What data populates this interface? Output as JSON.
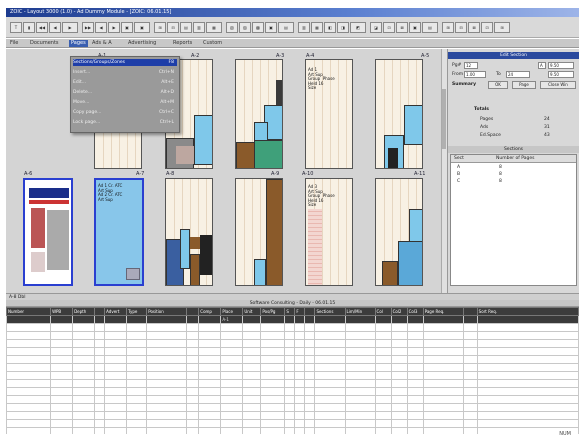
{
  "window": {
    "title": "ZOIC - Layout 3000 (1.0) - Ad Dummy Module - [ZOIC: 06.01.15]"
  },
  "toolbar": {
    "buttons": [
      "T",
      "▮",
      "◀◀",
      "◀",
      "▶",
      "▶▶",
      "◀",
      "▶",
      "▣",
      "▣",
      "⊞",
      "⊟",
      "▤",
      "▥",
      "▦",
      "▧",
      "▨",
      "▩",
      "▣",
      "▤",
      "▥",
      "▦",
      "◧",
      "◨",
      "◩",
      "◪",
      "⊡",
      "⊠",
      "▣",
      "▤",
      "⊞",
      "⊟",
      "⊠",
      "⊡",
      "⊞"
    ]
  },
  "menu": {
    "items": [
      "File",
      "Documents",
      "Pages",
      "Ads & A",
      "Advertising",
      "Reports",
      "Custom"
    ],
    "active_index": 2
  },
  "dropdown": {
    "items": [
      {
        "label": "Sections/Groups/Zones",
        "value": "F8",
        "highlight": true
      },
      {
        "label": "Insert...",
        "value": "Ctrl+N",
        "highlight": false
      },
      {
        "label": "Edit...",
        "value": "Alt+E",
        "highlight": false
      },
      {
        "label": "Delete...",
        "value": "Alt+D",
        "highlight": false
      },
      {
        "label": "Move...",
        "value": "Alt+M",
        "highlight": false
      },
      {
        "label": "Copy page...",
        "value": "Ctrl+C",
        "highlight": false
      },
      {
        "label": "Lock page...",
        "value": "Ctrl+L",
        "highlight": false
      }
    ]
  },
  "pages_row1": [
    {
      "label": "A-1"
    },
    {
      "label": "A-2"
    },
    {
      "label": "A-3"
    },
    {
      "label": "A-4"
    },
    {
      "label": "A-5"
    }
  ],
  "pages_row2": [
    {
      "label": "A-6"
    },
    {
      "label": "A-7"
    },
    {
      "label": "A-8"
    },
    {
      "label": "A-9"
    },
    {
      "label": "A-10"
    },
    {
      "label": "A-11"
    }
  ],
  "page_texts": {
    "a4": "Ad 1\nArt Sup\nGroup  Phase\nHeld 16\nSize",
    "a7": "Ad 1 Cr. ATC\nArt Sup\nAd 2 Cr. ATC\nArt Sup",
    "a10": "Ad 3\nArt Sup\nGroup  Phase\nHeld 16\nSize"
  },
  "right_panel": {
    "header": "Edit Section",
    "labels": {
      "pg": "Pg#",
      "from": "From",
      "to": "To",
      "summary": "Summary",
      "totals": "Totals",
      "pages": "Pages",
      "ads": "Ads",
      "edit_space": "Ed.Space"
    },
    "fields": {
      "pg": "12",
      "from": "1.00",
      "to": "24",
      "a": "A",
      "b": "9.50",
      "c": "9.50"
    },
    "buttons": {
      "ok": "OK",
      "page": "Page",
      "close": "Close Win"
    },
    "totals": {
      "pages": "24",
      "ads": "31",
      "edit_space": "43"
    },
    "sections_header": "Sections",
    "sections_cols": [
      "Sect",
      "Number of Pages"
    ],
    "sections": [
      {
        "sect": "A",
        "pages": "8"
      },
      {
        "sect": "B",
        "pages": "8"
      },
      {
        "sect": "C",
        "pages": "8"
      }
    ]
  },
  "status": {
    "text": "A-8 Dbl"
  },
  "grid": {
    "caption": "Software Consulting - Daily - 06.01.15",
    "columns": [
      "Number",
      "WPB",
      "Depth",
      "",
      "Advert",
      "Type",
      "Position",
      "",
      "Comp",
      "Place",
      "Unit",
      "Pos/Pg",
      "S",
      "F",
      "",
      "Sections",
      "Lim/Min",
      "Col",
      "Col2",
      "Col3",
      "Page Req.",
      "",
      "Sort Req."
    ],
    "first_row": [
      "",
      "",
      "",
      "",
      "",
      "",
      "",
      "",
      "",
      "A-1",
      "",
      "",
      "",
      "",
      "",
      "",
      "",
      "",
      "",
      "",
      "",
      "",
      ""
    ],
    "empty_rows": 16
  },
  "bottom": {
    "text": "NUM"
  }
}
